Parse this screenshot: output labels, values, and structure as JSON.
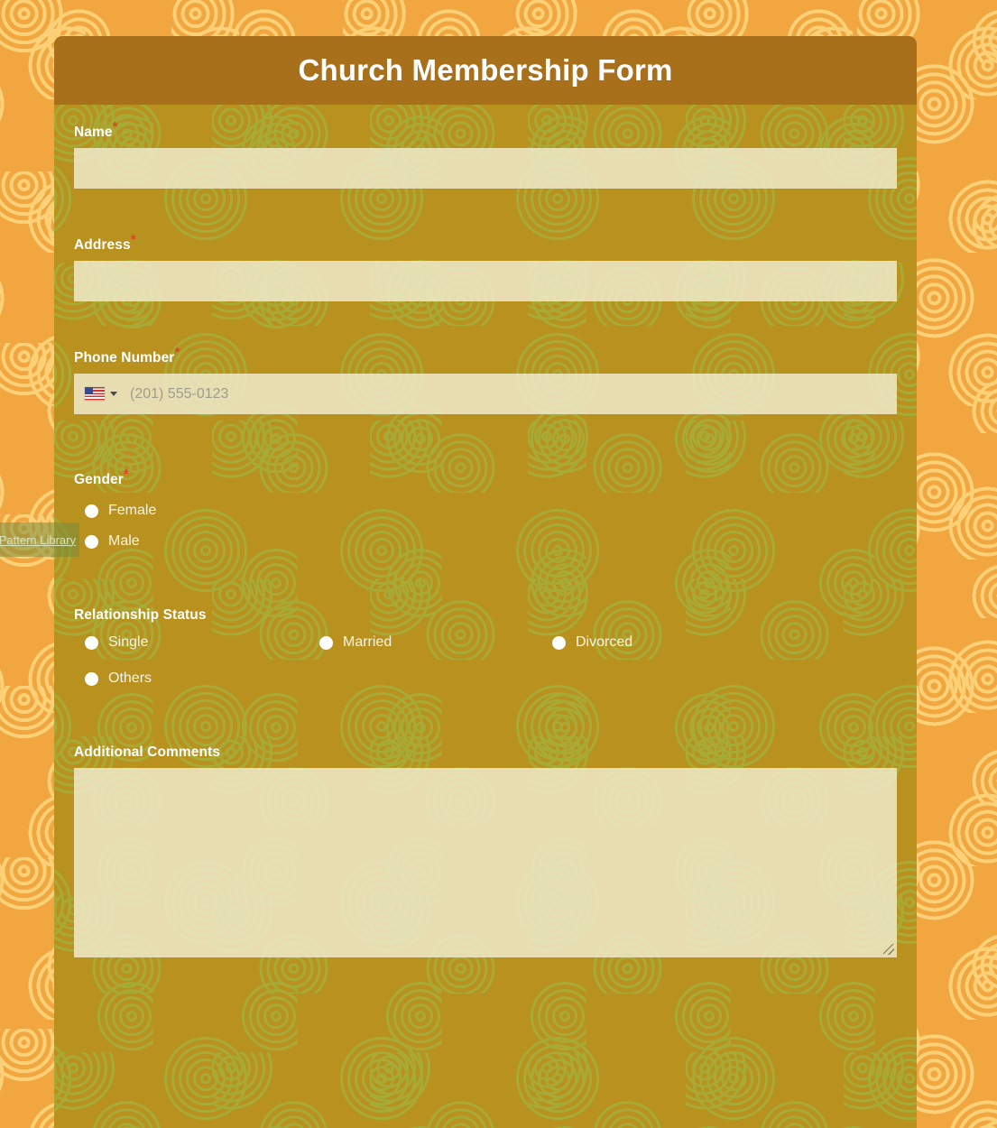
{
  "page": {
    "background_color": "#f2a63f",
    "background_accent": "#fbd077"
  },
  "form": {
    "title": "Church Membership Form",
    "header_color": "#a8701a",
    "body_color": "#b8911f",
    "body_accent": "#a7aa35",
    "required_marker": "*",
    "required_marker_color": "#e0412c",
    "fields": [
      {
        "id": "name",
        "label": "Name",
        "required": true,
        "type": "text",
        "value": "",
        "placeholder": ""
      },
      {
        "id": "address",
        "label": "Address",
        "required": true,
        "type": "text",
        "value": "",
        "placeholder": ""
      },
      {
        "id": "phone",
        "label": "Phone Number",
        "required": true,
        "type": "tel",
        "value": "",
        "placeholder": "(201) 555-0123",
        "country_flag": "us-flag-icon",
        "dropdown_icon": "caret-down-icon"
      },
      {
        "id": "gender",
        "label": "Gender",
        "required": true,
        "type": "radio",
        "options": [
          "Female",
          "Male"
        ],
        "selected": ""
      },
      {
        "id": "relationship_status",
        "label": "Relationship Status",
        "required": false,
        "type": "radio",
        "options": [
          "Single",
          "Married",
          "Divorced",
          "Others"
        ],
        "selected": ""
      },
      {
        "id": "additional_comments",
        "label": "Additional Comments",
        "required": false,
        "type": "textarea",
        "value": "",
        "placeholder": ""
      }
    ]
  },
  "watermark": {
    "label": "Pattern Library"
  }
}
